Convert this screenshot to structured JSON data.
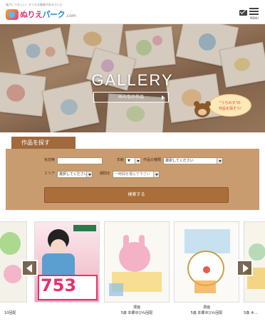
{
  "header": {
    "tagline": "親子にうれしい！すてきな情報があるさいと",
    "logo_main": "ぬりえ",
    "logo_accent": "パーク",
    "logo_com": ".com",
    "menu_label": "MENU"
  },
  "hero": {
    "title": "GALLERY",
    "subtitle": "みんなの作品",
    "badge_line1": "\"うちの子\"の",
    "badge_line2": "作品を探そう!"
  },
  "search": {
    "tab_label": "作品を探す",
    "name_label": "名前等",
    "name_value": "",
    "age_label": "年齢",
    "age_value": "▼",
    "category_label": "作品の種類",
    "category_value": "選択してください",
    "area_label": "エリア",
    "area_value": "選択してください",
    "period_label": "期間を",
    "period_placeholder": "一時間を選んで下さい",
    "submit_label": "検索する"
  },
  "gallery": {
    "items": [
      {
        "caption1": "",
        "caption2": "10回配"
      },
      {
        "caption1": "",
        "caption2": "",
        "promo": "753"
      },
      {
        "caption1": "漫画",
        "caption2": "5歳 本郷ゆびわ回配"
      },
      {
        "caption1": "漫画",
        "caption2": "5歳 本郷ゆびわ回配"
      },
      {
        "caption1": "",
        "caption2": "5歳 木..."
      }
    ],
    "prev_label": "",
    "next_label": ""
  },
  "colors": {
    "panel": "#c99c6f",
    "tab": "#a06a3c",
    "button": "#a96e3a",
    "logo_pink": "#e8306f"
  }
}
